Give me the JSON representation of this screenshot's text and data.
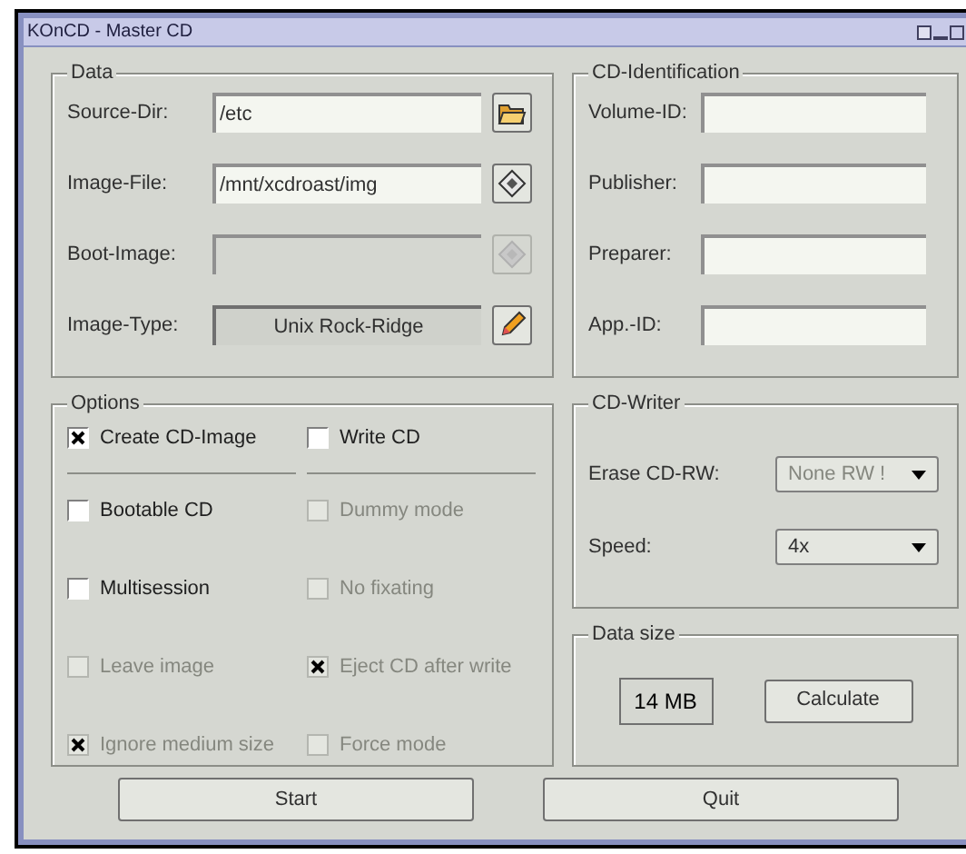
{
  "window": {
    "title": "KOnCD - Master CD"
  },
  "data": {
    "title": "Data",
    "rows": [
      {
        "label": "Source-Dir:",
        "kind": "field",
        "value": "/etc",
        "disabled": false
      },
      {
        "label": "Image-File:",
        "kind": "field",
        "value": "/mnt/xcdroast/img",
        "disabled": false
      },
      {
        "label": "Boot-Image:",
        "kind": "field",
        "disabled": true
      },
      {
        "label": "Image-Type:",
        "kind": "display",
        "value": "Unix Rock-Ridge"
      }
    ]
  },
  "cd_identification": {
    "title": "CD-Identification",
    "fields": [
      {
        "label": "Volume-ID:"
      },
      {
        "label": "Publisher:"
      },
      {
        "label": "Preparer:"
      },
      {
        "label": "App.-ID:"
      }
    ]
  },
  "options": {
    "title": "Options",
    "columns": [
      [
        {
          "label": "Create CD-Image",
          "checked": true,
          "disabled": false
        },
        {
          "label": "Bootable CD",
          "checked": false,
          "disabled": false
        },
        {
          "label": "Multisession",
          "checked": false,
          "disabled": false
        },
        {
          "label": "Leave image",
          "checked": false,
          "disabled": true
        },
        {
          "label": "Ignore medium size",
          "checked": true,
          "disabled": true
        }
      ],
      [
        {
          "label": "Write CD",
          "checked": false,
          "disabled": false
        },
        {
          "label": "Dummy mode",
          "checked": false,
          "disabled": true
        },
        {
          "label": "No fixating",
          "checked": false,
          "disabled": true
        },
        {
          "label": "Eject CD after write",
          "checked": true,
          "disabled": true
        },
        {
          "label": "Force mode",
          "checked": false,
          "disabled": true
        }
      ]
    ]
  },
  "cd_writer": {
    "title": "CD-Writer",
    "selects": [
      {
        "label": "Erase CD-RW:",
        "value": "None RW !",
        "disabled": true
      },
      {
        "label": "Speed:",
        "value": "4x",
        "disabled": false
      }
    ]
  },
  "data_size": {
    "title": "Data size",
    "value": "14 MB",
    "button": "Calculate"
  },
  "buttons": [
    "Start",
    "Quit"
  ]
}
